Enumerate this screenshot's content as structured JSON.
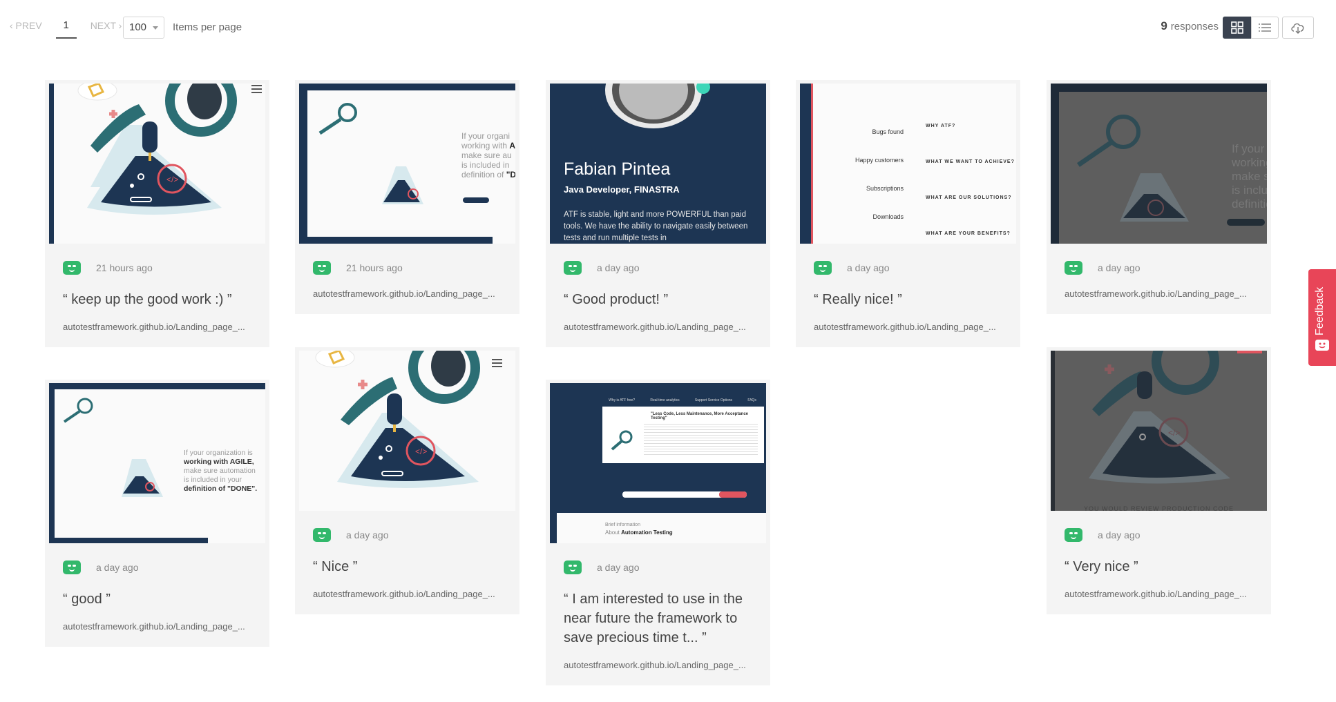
{
  "pagination": {
    "prev": "‹ PREV",
    "page": "1",
    "next": "NEXT ›",
    "per_page": "100",
    "per_page_label": "Items per page"
  },
  "responses": {
    "count": "9",
    "label": "responses"
  },
  "feedback_tab": "Feedback",
  "cards": [
    {
      "time": "21 hours ago",
      "quote": "“ keep up the good work :) ”",
      "url": "autotestframework.github.io/Landing_page_..."
    },
    {
      "time": "21 hours ago",
      "quote": "",
      "url": "autotestframework.github.io/Landing_page_..."
    },
    {
      "time": "a day ago",
      "quote": "“ Good product! ”",
      "url": "autotestframework.github.io/Landing_page_...",
      "thumb": {
        "name": "Fabian Pintea",
        "role": "Java Developer, FINASTRA",
        "text": "ATF is stable, light and more POWERFUL than paid tools. We have the ability to navigate easily between tests and run multiple tests in"
      }
    },
    {
      "time": "a day ago",
      "quote": "“ Really nice! ”",
      "url": "autotestframework.github.io/Landing_page_...",
      "thumb": {
        "stats": [
          "Bugs found",
          "Happy customers",
          "Subscriptions",
          "Downloads"
        ],
        "headings": [
          "WHY ATF?",
          "WHAT WE WANT TO ACHIEVE?",
          "WHAT ARE OUR SOLUTIONS?",
          "WHAT ARE YOUR BENEFITS?"
        ]
      }
    },
    {
      "time": "a day ago",
      "quote": "",
      "url": "autotestframework.github.io/Landing_page_..."
    },
    {
      "time": "a day ago",
      "quote": "“ good ”",
      "url": "autotestframework.github.io/Landing_page_...",
      "thumb": {
        "l1": "If your organization is",
        "l2": "working with AGILE,",
        "l3": "make sure automation",
        "l4": "is included in your",
        "l5": "definition of \"DONE\"."
      }
    },
    {
      "time": "a day ago",
      "quote": "“ Nice ”",
      "url": "autotestframework.github.io/Landing_page_..."
    },
    {
      "time": "a day ago",
      "quote": "“ I am interested to use in the near future the framework to save precious time t... ”",
      "url": "autotestframework.github.io/Landing_page_...",
      "thumb": {
        "heading": "\"Less Code, Less Maintenance, More Acceptance Testing\"",
        "tabs": [
          "Why is ATF free?",
          "Real-time analytics",
          "Support Service Options",
          "FAQs"
        ],
        "brief": "Brief information",
        "about": "About",
        "about_strong": "Automation Testing"
      }
    },
    {
      "time": "a day ago",
      "quote": "“ Very nice ”",
      "url": "autotestframework.github.io/Landing_page_...",
      "thumb": {
        "caption": "YOU WOULD REVIEW PRODUCTION CODE"
      }
    }
  ],
  "colors": {
    "accent_dark": "#3a4250",
    "badge_green": "#32b86b",
    "feedback_red": "#e84558",
    "navy": "#1d3553"
  }
}
